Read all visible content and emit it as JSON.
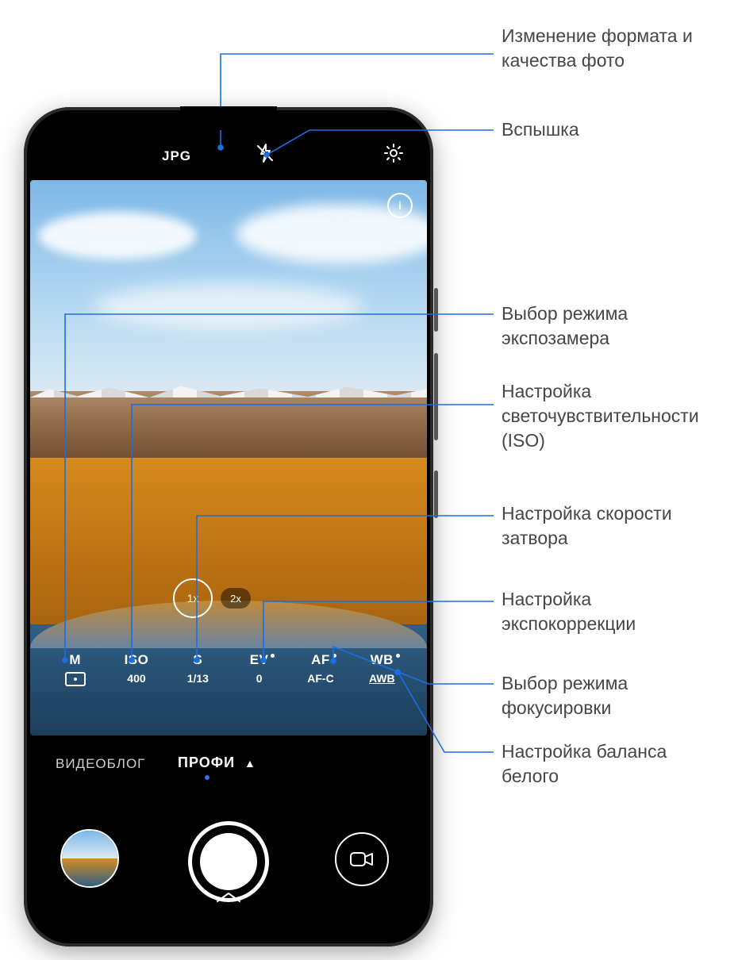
{
  "topbar": {
    "format_label": "JPG",
    "flash_icon": "flash-off-icon",
    "settings_icon": "gear-icon"
  },
  "viewfinder": {
    "info_icon": "info-icon"
  },
  "zoom": {
    "selected": "1x",
    "other": "2x"
  },
  "params": [
    {
      "key": "metering",
      "label": "M",
      "value_icon": "metering-matrix-icon"
    },
    {
      "key": "iso",
      "label": "ISO",
      "value": "400"
    },
    {
      "key": "shutter",
      "label": "S",
      "value": "1/13"
    },
    {
      "key": "ev",
      "label": "EV",
      "value": "0",
      "dot": true
    },
    {
      "key": "af",
      "label": "AF",
      "value": "AF-C",
      "dot": true
    },
    {
      "key": "wb",
      "label": "WB",
      "value": "AWB",
      "dot": true,
      "underline": true
    }
  ],
  "modes": {
    "video_blog": "ВИДЕОБЛОГ",
    "pro": "ПРОФИ",
    "chevron": "^"
  },
  "bottom": {
    "gallery": "gallery-thumbnail",
    "shutter": "shutter-button",
    "video_switch": "video-camera-icon",
    "swipe_up": "chevron-up-icon"
  },
  "callouts": {
    "format": "Изменение формата и качества фото",
    "flash": "Вспышка",
    "metering": "Выбор режима экспозамера",
    "iso": "Настройка светочувствительности  (ISO)",
    "shutter": "Настройка скорости затвора",
    "ev": "Настройка экспокоррекции",
    "af": "Выбор режима фокусировки",
    "wb": "Настройка баланса  белого"
  }
}
